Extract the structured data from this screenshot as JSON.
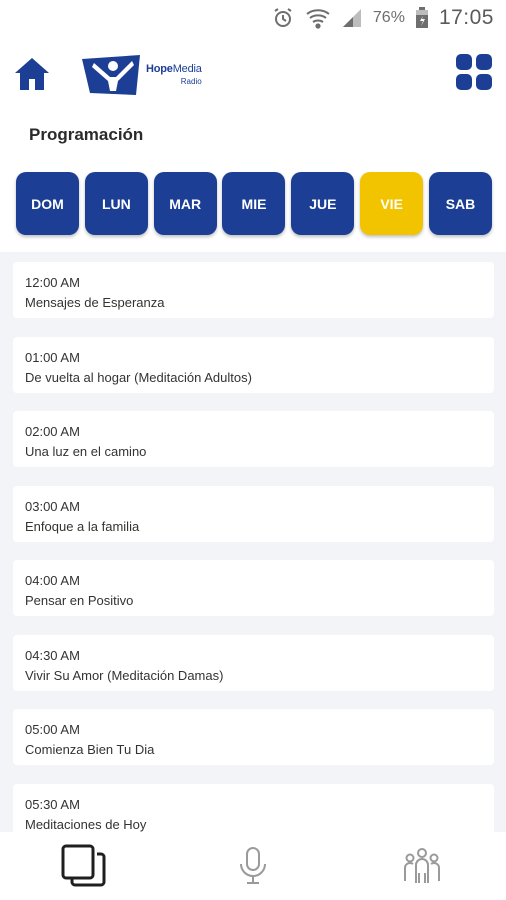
{
  "status_bar": {
    "battery": "76%",
    "time": "17:05",
    "icons": [
      "alarm-icon",
      "wifi-icon",
      "signal-icon",
      "battery-icon"
    ]
  },
  "header": {
    "brand_hope": "Hope",
    "brand_media": "Media",
    "brand_sub": "Radio",
    "icons": [
      "home-icon",
      "grid-menu-icon"
    ],
    "accent_color": "#1c3f95"
  },
  "section_title": "Programación",
  "days": [
    {
      "label": "DOM",
      "active": false
    },
    {
      "label": "LUN",
      "active": false
    },
    {
      "label": "MAR",
      "active": false
    },
    {
      "label": "MIE",
      "active": false
    },
    {
      "label": "JUE",
      "active": false
    },
    {
      "label": "VIE",
      "active": true
    },
    {
      "label": "SAB",
      "active": false
    }
  ],
  "day_colors": {
    "default": "#1c3f95",
    "active": "#f2c400"
  },
  "schedule": [
    {
      "time": "12:00 AM",
      "title": "Mensajes de Esperanza"
    },
    {
      "time": "01:00 AM",
      "title": "De vuelta al hogar (Meditación Adultos)"
    },
    {
      "time": "02:00 AM",
      "title": "Una luz en el camino"
    },
    {
      "time": "03:00 AM",
      "title": "Enfoque a la familia"
    },
    {
      "time": "04:00 AM",
      "title": "Pensar en Positivo"
    },
    {
      "time": "04:30 AM",
      "title": "Vivir Su Amor (Meditación Damas)"
    },
    {
      "time": "05:00 AM",
      "title": "Comienza Bien Tu Dia"
    },
    {
      "time": "05:30 AM",
      "title": "Meditaciones de Hoy"
    }
  ],
  "bottom_nav": [
    {
      "icon": "schedule-pages-icon",
      "active": true
    },
    {
      "icon": "microphone-icon",
      "active": false
    },
    {
      "icon": "community-people-icon",
      "active": false
    }
  ]
}
